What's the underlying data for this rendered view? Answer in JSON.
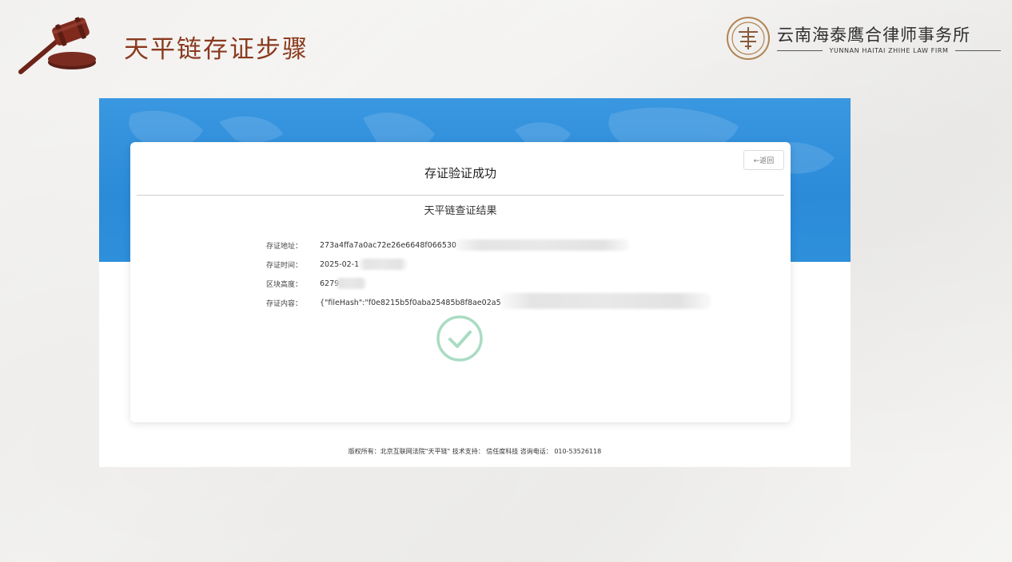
{
  "header": {
    "title": "天平链存证步骤"
  },
  "logo": {
    "name_cn": "云南海泰鹰合律师事务所",
    "name_en": "YUNNAN HAITAI ZHIHE LAW FIRM"
  },
  "result_card": {
    "back_label": "←返回",
    "title": "存证验证成功",
    "subtitle": "天平链查证结果",
    "fields": [
      {
        "label": "存证地址：",
        "value": "273a4ffa7a0ac72e26e6648f066530"
      },
      {
        "label": "存证时间：",
        "value": "2025-02-1"
      },
      {
        "label": "区块高度：",
        "value": "6279"
      },
      {
        "label": "存证内容：",
        "value": "{\"fileHash\":\"f0e8215b5f0aba25485b8f8ae02a5"
      }
    ],
    "status_icon": "check-circle-icon"
  },
  "footer": {
    "text": "版权所有：北京互联网法院\"天平链\" 技术支持： 信任度科技 咨询电话： 010-53526118"
  },
  "colors": {
    "title": "#8a3a1e",
    "banner": "#2b8bd9",
    "check": "#9fd9bd"
  }
}
